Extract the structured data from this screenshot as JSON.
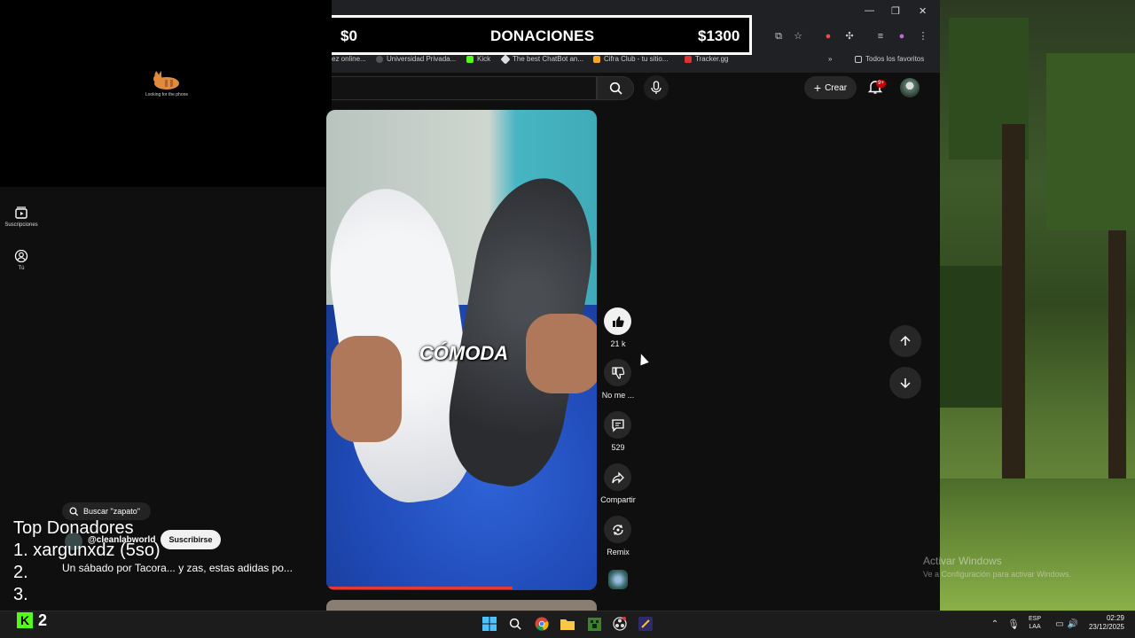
{
  "donation": {
    "min": "$0",
    "title": "DONACIONES",
    "max": "$1300"
  },
  "stream": {
    "cat_caption": "Looking for the phone"
  },
  "sidebar": {
    "items": [
      {
        "label": "Suscripciones",
        "icon": "subscriptions-icon"
      },
      {
        "label": "Tú",
        "icon": "account-icon"
      }
    ]
  },
  "bookmarks": [
    {
      "label": "ez online..."
    },
    {
      "label": "Universidad Privada..."
    },
    {
      "label": "Kick"
    },
    {
      "label": "The best ChatBot an..."
    },
    {
      "label": "Cifra Club - tu sitio..."
    },
    {
      "label": "Tracker.gg"
    }
  ],
  "bookmarks_all": "Todos los favoritos",
  "header": {
    "create_label": "Crear",
    "notifications_badge": "9+"
  },
  "video": {
    "caption_word": "CÓMODA",
    "progress_fraction": 0.69
  },
  "actions": {
    "likes": "21 k",
    "dislike_label": "No me ...",
    "comments": "529",
    "share_label": "Compartir",
    "remix_label": "Remix"
  },
  "overlay": {
    "sound_search": "Buscar \"zapato\"",
    "channel_handle": "@cleanlabworld",
    "subscribe_label": "Suscribirse",
    "video_title": "Un sábado por Tacora... y zas, estas adidas po..."
  },
  "donors": {
    "title": "Top Donadores",
    "lines": [
      "1. xargunxdz (5so)",
      "2.",
      "3."
    ]
  },
  "kick": {
    "count": "2"
  },
  "watermark": {
    "line1": "Activar Windows",
    "line2": "Ve a Configuración para activar Windows."
  },
  "taskbar": {
    "lang1": "ESP",
    "lang2": "LAA",
    "time": "02:29",
    "date": "23/12/2025"
  },
  "colors": {
    "accent_red": "#cc0000",
    "kick_green": "#53fc18",
    "yt_bg": "#0f0f0f"
  }
}
